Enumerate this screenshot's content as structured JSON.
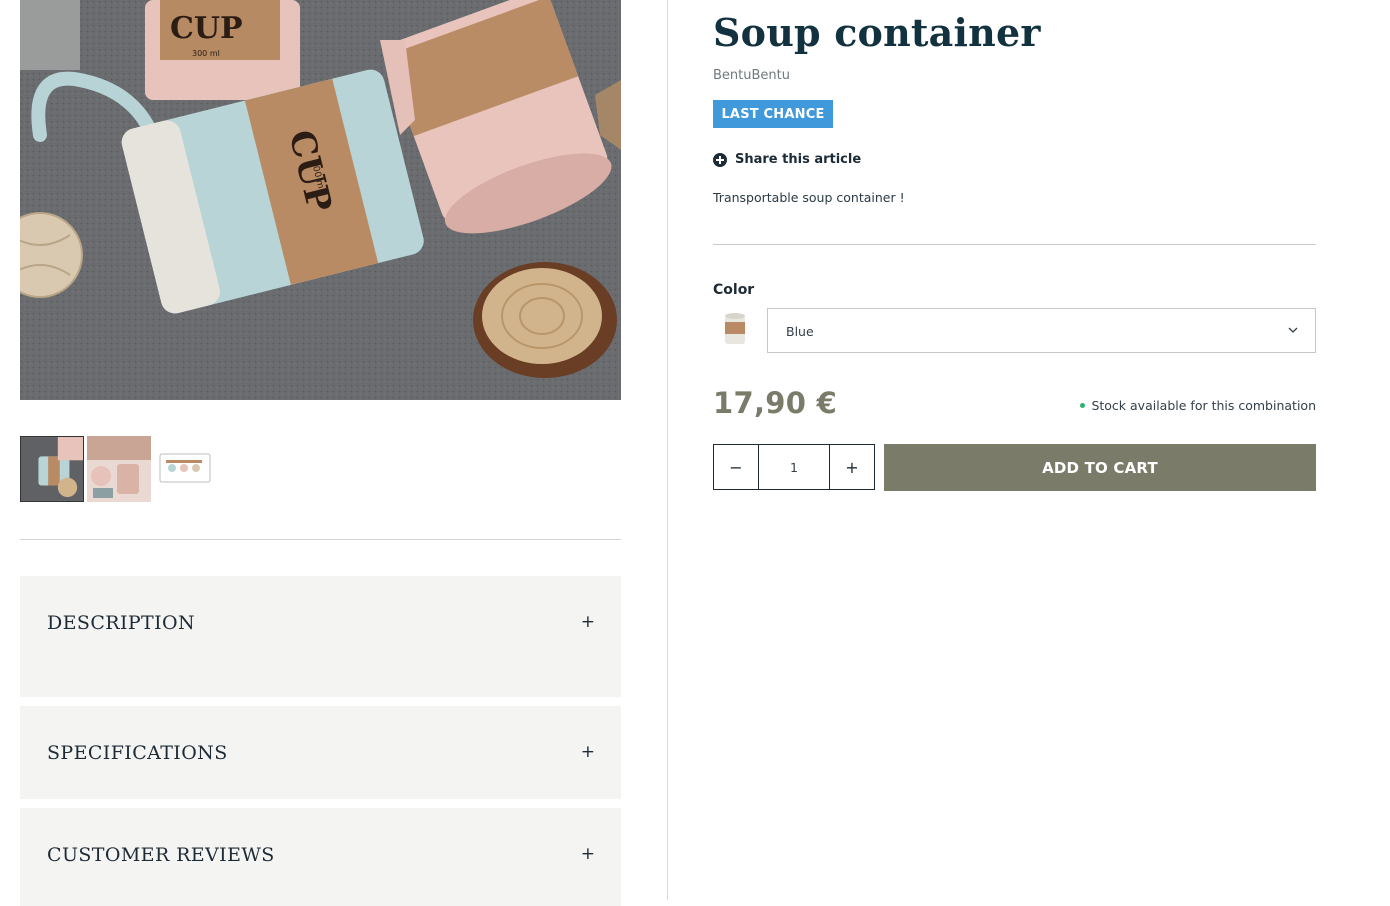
{
  "product": {
    "title": "Soup container",
    "brand": "BentuBentu",
    "badge": "LAST CHANCE",
    "share_label": "Share this article",
    "short_description": "Transportable soup container !",
    "price": "17,90 €",
    "stock_status": "Stock available for this combination"
  },
  "variant": {
    "label": "Color",
    "selected": "Blue"
  },
  "cart": {
    "quantity": "1",
    "minus_label": "−",
    "plus_label": "+",
    "add_label": "ADD TO CART"
  },
  "accordions": [
    {
      "title": "DESCRIPTION",
      "toggle": "+"
    },
    {
      "title": "SPECIFICATIONS",
      "toggle": "+"
    },
    {
      "title": "CUSTOMER REVIEWS",
      "toggle": "+"
    }
  ],
  "main_image_text": {
    "cup_label_1": "CUP",
    "cup_label_2": "CUP",
    "capacity_1": "300 ml",
    "capacity_2": "300 ml"
  },
  "colors": {
    "accent": "#7a7b69",
    "badge": "#3f99db",
    "title": "#13323f",
    "stock_dot": "#2bb36f",
    "accordion_bg": "#f4f4f2"
  },
  "icons": {
    "share": "plus-circle-icon",
    "dropdown": "chevron-down-icon"
  }
}
